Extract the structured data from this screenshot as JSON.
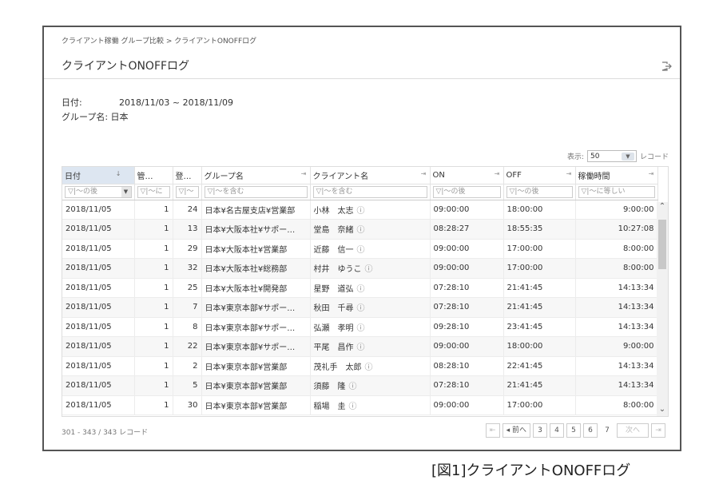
{
  "breadcrumb": "クライアント稼働 グループ比較 > クライアントONOFFログ",
  "title": "クライアントONOFFログ",
  "info": {
    "date_label": "日付:",
    "date_value": "2018/11/03 ~ 2018/11/09",
    "group_label": "グループ名:",
    "group_value": "日本"
  },
  "display": {
    "label": "表示:",
    "value": "50",
    "unit": "レコード"
  },
  "columns": [
    {
      "label": "日付",
      "filter": "▽|〜の後"
    },
    {
      "label": "管…",
      "filter": "▽|〜に"
    },
    {
      "label": "登…",
      "filter": "▽|〜"
    },
    {
      "label": "グループ名",
      "filter": "▽|〜を含む"
    },
    {
      "label": "クライアント名",
      "filter": "▽|〜を含む"
    },
    {
      "label": "ON",
      "filter": "▽|〜の後"
    },
    {
      "label": "OFF",
      "filter": "▽|〜の後"
    },
    {
      "label": "稼働時間",
      "filter": "▽|〜に等しい"
    }
  ],
  "rows": [
    [
      "2018/11/05",
      "1",
      "24",
      "日本¥名古屋支店¥営業部",
      "小林　太志",
      "09:00:00",
      "18:00:00",
      "9:00:00"
    ],
    [
      "2018/11/05",
      "1",
      "13",
      "日本¥大阪本社¥サポー…",
      "堂島　奈緒",
      "08:28:27",
      "18:55:35",
      "10:27:08"
    ],
    [
      "2018/11/05",
      "1",
      "29",
      "日本¥大阪本社¥営業部",
      "近藤　信一",
      "09:00:00",
      "17:00:00",
      "8:00:00"
    ],
    [
      "2018/11/05",
      "1",
      "32",
      "日本¥大阪本社¥総務部",
      "村井　ゆうこ",
      "09:00:00",
      "17:00:00",
      "8:00:00"
    ],
    [
      "2018/11/05",
      "1",
      "25",
      "日本¥大阪本社¥開発部",
      "星野　道弘",
      "07:28:10",
      "21:41:45",
      "14:13:34"
    ],
    [
      "2018/11/05",
      "1",
      "7",
      "日本¥東京本部¥サポー…",
      "秋田　千尋",
      "07:28:10",
      "21:41:45",
      "14:13:34"
    ],
    [
      "2018/11/05",
      "1",
      "8",
      "日本¥東京本部¥サポー…",
      "弘瀬　孝明",
      "09:28:10",
      "23:41:45",
      "14:13:34"
    ],
    [
      "2018/11/05",
      "1",
      "22",
      "日本¥東京本部¥サポー…",
      "平尾　昌作",
      "09:00:00",
      "18:00:00",
      "9:00:00"
    ],
    [
      "2018/11/05",
      "1",
      "2",
      "日本¥東京本部¥営業部",
      "茂礼手　太郎",
      "08:28:10",
      "22:41:45",
      "14:13:34"
    ],
    [
      "2018/11/05",
      "1",
      "5",
      "日本¥東京本部¥営業部",
      "須藤　隆",
      "07:28:10",
      "21:41:45",
      "14:13:34"
    ],
    [
      "2018/11/05",
      "1",
      "30",
      "日本¥東京本部¥営業部",
      "稲場　圭",
      "09:00:00",
      "17:00:00",
      "8:00:00"
    ]
  ],
  "footer": {
    "count": "301 - 343 / 343 レコード",
    "first": "⇤",
    "prev": "◂ 前へ",
    "pages": [
      "3",
      "4",
      "5",
      "6",
      "7"
    ],
    "current_page": "7",
    "next": "次へ",
    "last": "⇥"
  },
  "caption": "[図1]クライアントONOFFログ"
}
